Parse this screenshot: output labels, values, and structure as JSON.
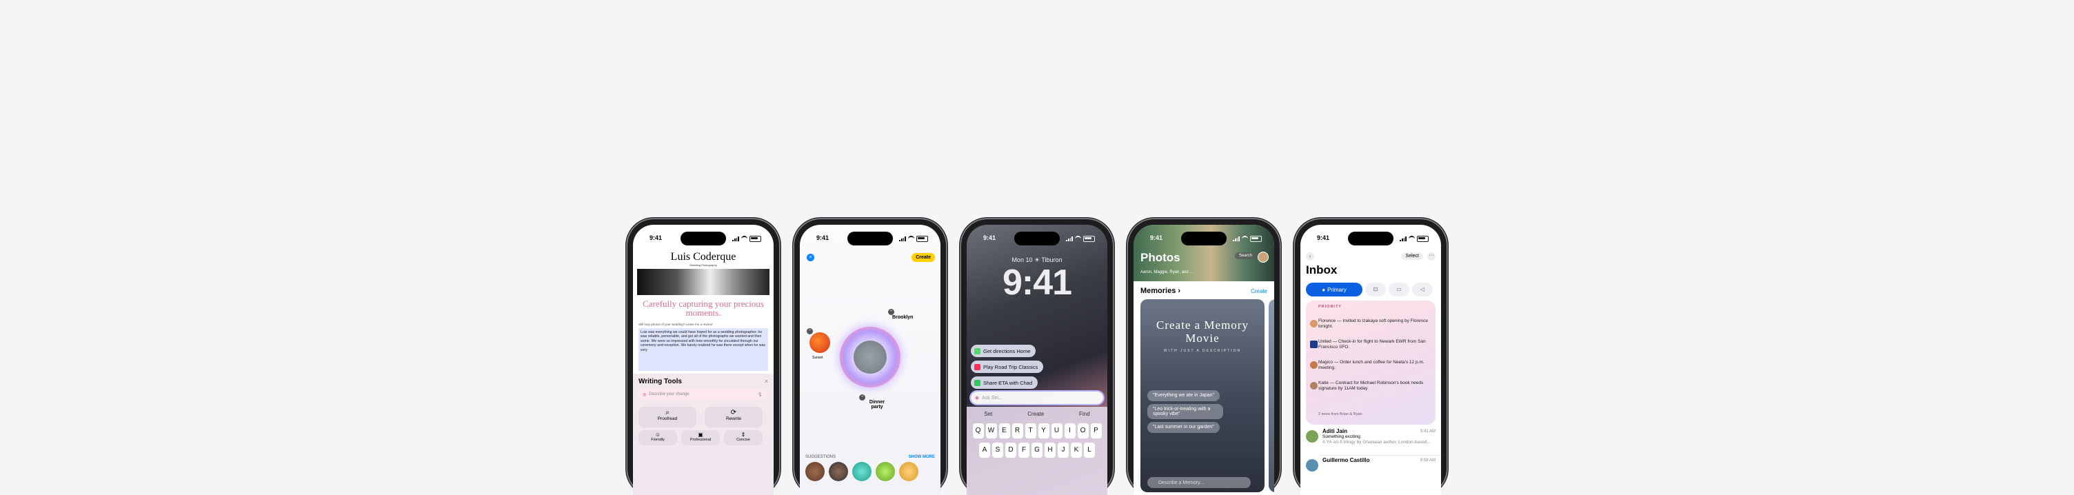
{
  "status": {
    "time": "9:41"
  },
  "phone1": {
    "masthead": "Luis Coderque",
    "masthead_sub": "Wedding Photography",
    "headline": "Carefully capturing your precious moments.",
    "teaser": "Still loop photos of your wedding? Leave me a review!",
    "selected_text": "Luis was everything we could have hoped for as a wedding photographer. he was reliable, personable, and got all of the photographs we wanted and then some. We were so impressed with how smoothly he circulated through our ceremony and reception. We barely realized he was there except when he was very",
    "writing_tools_title": "Writing Tools",
    "close": "×",
    "describe_placeholder": "Describe your change",
    "proofread": "Proofread",
    "rewrite": "Rewrite",
    "friendly": "Friendly",
    "professional": "Professional",
    "concise": "Concise"
  },
  "phone2": {
    "create": "Create",
    "brooklyn": "Brooklyn",
    "sunset": "Sunset",
    "dinner_party": "Dinner party",
    "suggestions": "SUGGESTIONS",
    "show_more": "SHOW MORE"
  },
  "phone3": {
    "date": "Mon 10 ☀ Tiburon",
    "clock": "9:41",
    "sugg1": "Get directions Home",
    "sugg2": "Play Road Trip Classics",
    "sugg3": "Share ETA with Chad",
    "ask_placeholder": "Ask Siri...",
    "predictions": [
      "Set",
      "Create",
      "Find"
    ],
    "row1": [
      "Q",
      "W",
      "E",
      "R",
      "T",
      "Y",
      "U",
      "I",
      "O",
      "P"
    ],
    "row2": [
      "A",
      "S",
      "D",
      "F",
      "G",
      "H",
      "J",
      "K",
      "L"
    ]
  },
  "phone4": {
    "title": "Photos",
    "search": "Search",
    "hero_caption": "Aaron, Maggie, Ryan, and ...",
    "memories": "Memories",
    "create": "Create",
    "card_title": "Create a Memory Movie",
    "card_sub": "WITH JUST A DESCRIPTION",
    "prompt1": "\"Everything we ate in Japan\"",
    "prompt2": "\"Leo trick-or-treating with a spooky vibe\"",
    "prompt3": "\"Last summer in our garden\"",
    "describe": "Describe a Memory..."
  },
  "phone5": {
    "select": "Select",
    "more": "···",
    "title": "Inbox",
    "primary": "Primary",
    "priority": "PRIORITY",
    "rows": [
      {
        "text": "Florence — Invited to Izakaya soft opening by Florence tonight."
      },
      {
        "text": "United — Check-in for flight to Newark EWR from San Francisco SFO."
      },
      {
        "text": "Magico — Order lunch and coffee for Neeta's 12 p.m. meeting."
      },
      {
        "text": "Katie — Contract for Michael Robinson's book needs signature by 11AM today."
      }
    ],
    "more_from": "2 more from Brian & Ryan",
    "mail1": {
      "name": "Aditi Jain",
      "date": "9:41 AM",
      "subject": "Something exciting",
      "preview": "A YA sci-fi trilogy by Ghanaian author, London-based..."
    },
    "mail2": {
      "name": "Guillermo Castillo",
      "date": "8:58 AM"
    }
  },
  "colors": {
    "accent_blue": "#0a84ff",
    "create_yellow": "#ffcf00",
    "headline_pink": "#e16b8c",
    "primary_blue": "#0a60e0"
  }
}
